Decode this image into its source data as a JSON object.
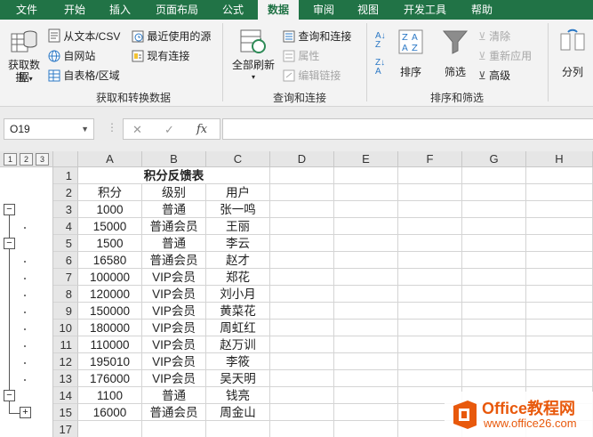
{
  "tabs": [
    "文件",
    "开始",
    "插入",
    "页面布局",
    "公式",
    "数据",
    "审阅",
    "视图",
    "开发工具",
    "帮助"
  ],
  "active_tab": "数据",
  "ribbon": {
    "get_data": "获取数据",
    "get_data2": "据",
    "from_text_csv": "从文本/CSV",
    "from_web": "自网站",
    "from_table": "自表格/区域",
    "recent_sources": "最近使用的源",
    "existing_connections": "现有连接",
    "group_get_transform": "获取和转换数据",
    "refresh_all": "全部刷新",
    "queries_connections": "查询和连接",
    "properties": "属性",
    "edit_links": "编辑链接",
    "group_queries": "查询和连接",
    "sort": "排序",
    "filter": "筛选",
    "clear": "清除",
    "reapply": "重新应用",
    "advanced": "高级",
    "group_sort_filter": "排序和筛选",
    "split_columns": "分列"
  },
  "formula_bar": {
    "name_box": "O19",
    "fx": "fx",
    "cancel": "✕",
    "enter": "✓",
    "formula": ""
  },
  "outline_levels": [
    "1",
    "2",
    "3"
  ],
  "columns": [
    "A",
    "B",
    "C",
    "D",
    "E",
    "F",
    "G",
    "H"
  ],
  "rows": [
    {
      "n": "1",
      "a": "积分反馈表",
      "b": "",
      "c": ""
    },
    {
      "n": "2",
      "a": "积分",
      "b": "级别",
      "c": "用户"
    },
    {
      "n": "3",
      "a": "1000",
      "b": "普通",
      "c": "张一鸣"
    },
    {
      "n": "4",
      "a": "15000",
      "b": "普通会员",
      "c": "王丽"
    },
    {
      "n": "5",
      "a": "1500",
      "b": "普通",
      "c": "李云"
    },
    {
      "n": "6",
      "a": "16580",
      "b": "普通会员",
      "c": "赵才"
    },
    {
      "n": "7",
      "a": "100000",
      "b": "VIP会员",
      "c": "郑花"
    },
    {
      "n": "8",
      "a": "120000",
      "b": "VIP会员",
      "c": "刘小月"
    },
    {
      "n": "9",
      "a": "150000",
      "b": "VIP会员",
      "c": "黄菜花"
    },
    {
      "n": "10",
      "a": "180000",
      "b": "VIP会员",
      "c": "周虹红"
    },
    {
      "n": "11",
      "a": "110000",
      "b": "VIP会员",
      "c": "赵万训"
    },
    {
      "n": "12",
      "a": "195010",
      "b": "VIP会员",
      "c": "李筱"
    },
    {
      "n": "13",
      "a": "176000",
      "b": "VIP会员",
      "c": "吴天明"
    },
    {
      "n": "14",
      "a": "1100",
      "b": "普通",
      "c": "钱亮"
    },
    {
      "n": "15",
      "a": "16000",
      "b": "普通会员",
      "c": "周金山"
    },
    {
      "n": "17",
      "a": "",
      "b": "",
      "c": ""
    }
  ],
  "watermark": {
    "brand": "Office教程网",
    "url": "www.office26.com"
  },
  "colors": {
    "excel_green": "#217346",
    "ribbon_bg": "#f3f3f3",
    "watermark_orange": "#e8590c"
  }
}
